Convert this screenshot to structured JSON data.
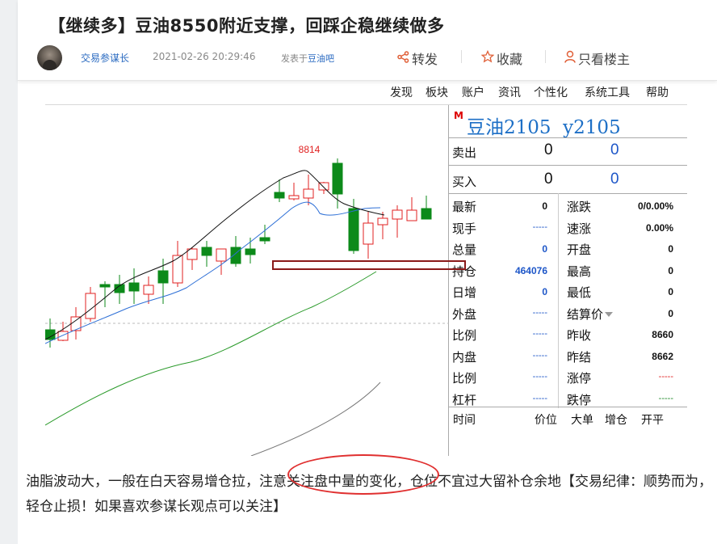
{
  "post": {
    "title": "【继续多】豆油8550附近支撑，回踩企稳继续做多",
    "author": "交易参谋长",
    "time": "2021-02-26 20:29:46",
    "posted_in": "发表于",
    "forum": "豆油吧",
    "actions": {
      "share": "转发",
      "favorite": "收藏",
      "only_op": "只看楼主"
    }
  },
  "terminal": {
    "menu": [
      "发现",
      "板块",
      "账户",
      "资讯",
      "个性化",
      "系统工具",
      "帮助"
    ],
    "chart_high_label": "8814",
    "quote": {
      "marker": "M",
      "name": "豆油2105",
      "code": "y2105",
      "sell_label": "卖出",
      "sell_price": "0",
      "sell_volume": "0",
      "buy_label": "买入",
      "buy_price": "0",
      "buy_volume": "0",
      "rows_left": [
        {
          "label": "最新",
          "value": "0",
          "style": "black"
        },
        {
          "label": "现手",
          "value": "-----",
          "style": "dash-blue"
        },
        {
          "label": "总量",
          "value": "0",
          "style": "blue"
        },
        {
          "label": "持仓",
          "value": "464076",
          "style": "blue"
        },
        {
          "label": "日增",
          "value": "0",
          "style": "blue"
        },
        {
          "label": "外盘",
          "value": "-----",
          "style": "dash-blue"
        },
        {
          "label": "比例",
          "value": "-----",
          "style": "dash-blue"
        },
        {
          "label": "内盘",
          "value": "-----",
          "style": "dash-blue"
        },
        {
          "label": "比例",
          "value": "-----",
          "style": "dash-blue"
        },
        {
          "label": "杠杆",
          "value": "-----",
          "style": "dash-blue"
        }
      ],
      "rows_right": [
        {
          "label": "涨跌",
          "value": "0/0.00%",
          "style": "black"
        },
        {
          "label": "速涨",
          "value": "0.00%",
          "style": "black"
        },
        {
          "label": "开盘",
          "value": "0",
          "style": "black"
        },
        {
          "label": "最高",
          "value": "0",
          "style": "black"
        },
        {
          "label": "最低",
          "value": "0",
          "style": "black"
        },
        {
          "label": "结算价",
          "value": "0",
          "style": "black"
        },
        {
          "label": "昨收",
          "value": "8660",
          "style": "black"
        },
        {
          "label": "昨结",
          "value": "8662",
          "style": "black"
        },
        {
          "label": "涨停",
          "value": "-----",
          "style": "dash-red"
        },
        {
          "label": "跌停",
          "value": "-----",
          "style": "dash-green"
        }
      ],
      "tick_headers": [
        "时间",
        "价位",
        "大单",
        "增仓",
        "开平"
      ]
    }
  },
  "caption": "油脂波动大，一般在白天容易增仓拉，注意关注盘中量的变化，仓位不宜过大留补仓余地【交易纪律：顺势而为，轻仓止损！如果喜欢参谋长观点可以关注】",
  "colors": {
    "up": "#e02020",
    "down": "#0c8a1a",
    "ma_short": "#111111",
    "ma_mid": "#2d6fd6",
    "ma_long": "#2a9a2a",
    "ma_longest": "#777777",
    "link": "#2b6bc1"
  }
}
